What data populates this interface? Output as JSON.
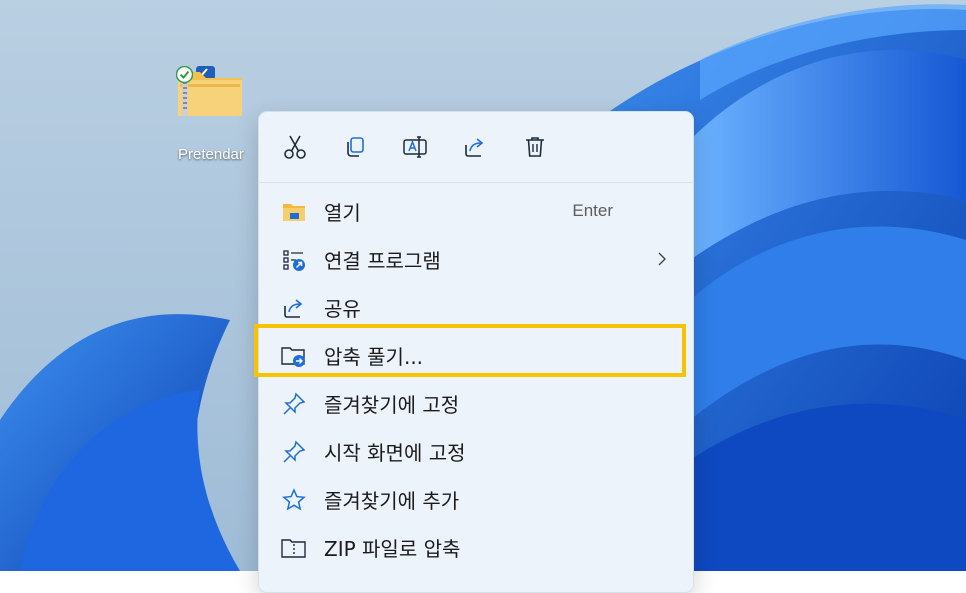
{
  "desktop": {
    "file_icon": {
      "label": "Pretendar",
      "selected": true,
      "sync_status": "available"
    },
    "accent_color": "#1a73e8"
  },
  "context_menu": {
    "quick_actions": [
      {
        "name": "cut",
        "icon": "scissors-icon"
      },
      {
        "name": "copy",
        "icon": "copy-icon"
      },
      {
        "name": "rename",
        "icon": "rename-icon"
      },
      {
        "name": "share",
        "icon": "share-icon"
      },
      {
        "name": "delete",
        "icon": "trash-icon"
      }
    ],
    "items": [
      {
        "label": "열기",
        "shortcut": "Enter",
        "icon": "folder-icon"
      },
      {
        "label": "연결 프로그램",
        "has_submenu": true,
        "icon": "open-with-icon"
      },
      {
        "label": "공유",
        "icon": "share-icon"
      },
      {
        "label": "압축 풀기...",
        "icon": "extract-icon",
        "highlighted": true
      },
      {
        "label": "즐겨찾기에 고정",
        "icon": "pin-icon"
      },
      {
        "label": "시작 화면에 고정",
        "icon": "pin-icon"
      },
      {
        "label": "즐겨찾기에 추가",
        "icon": "star-icon"
      },
      {
        "label": "ZIP 파일로 압축",
        "icon": "zip-icon"
      }
    ],
    "highlight_color": "#f5c300"
  }
}
